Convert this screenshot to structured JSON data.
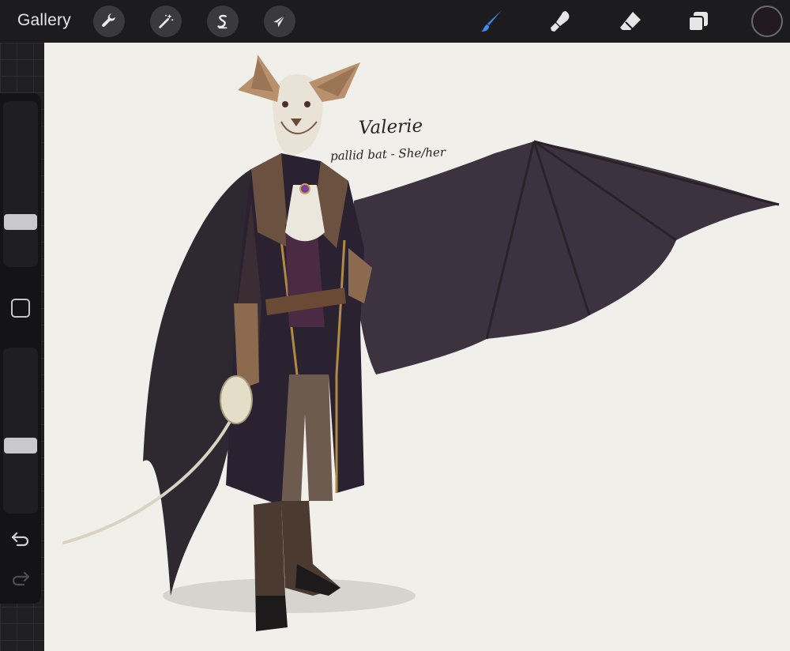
{
  "app": {
    "gallery_label": "Gallery"
  },
  "toolbar": {
    "left_tools": [
      {
        "name": "actions",
        "icon": "wrench-icon"
      },
      {
        "name": "adjustments",
        "icon": "magic-wand-icon"
      },
      {
        "name": "selection",
        "icon": "selection-s-icon"
      },
      {
        "name": "transform",
        "icon": "arrow-cursor-icon"
      }
    ],
    "right_tools": [
      {
        "name": "brush",
        "icon": "brush-icon",
        "active": true
      },
      {
        "name": "smudge",
        "icon": "smudge-icon",
        "active": false
      },
      {
        "name": "eraser",
        "icon": "eraser-icon",
        "active": false
      },
      {
        "name": "layers",
        "icon": "layers-icon",
        "active": false
      }
    ],
    "active_color": "#221a1f",
    "accent_color": "#3d8af7"
  },
  "sidebar": {
    "brush_size_level": 0.25,
    "opacity_level": 0.4,
    "modify_icon": "square-icon",
    "undo_icon": "undo-icon",
    "redo_icon": "redo-icon"
  },
  "canvas": {
    "background": "#f1efea",
    "character_name": "Valerie",
    "character_subtitle": "pallid bat - She/her"
  }
}
